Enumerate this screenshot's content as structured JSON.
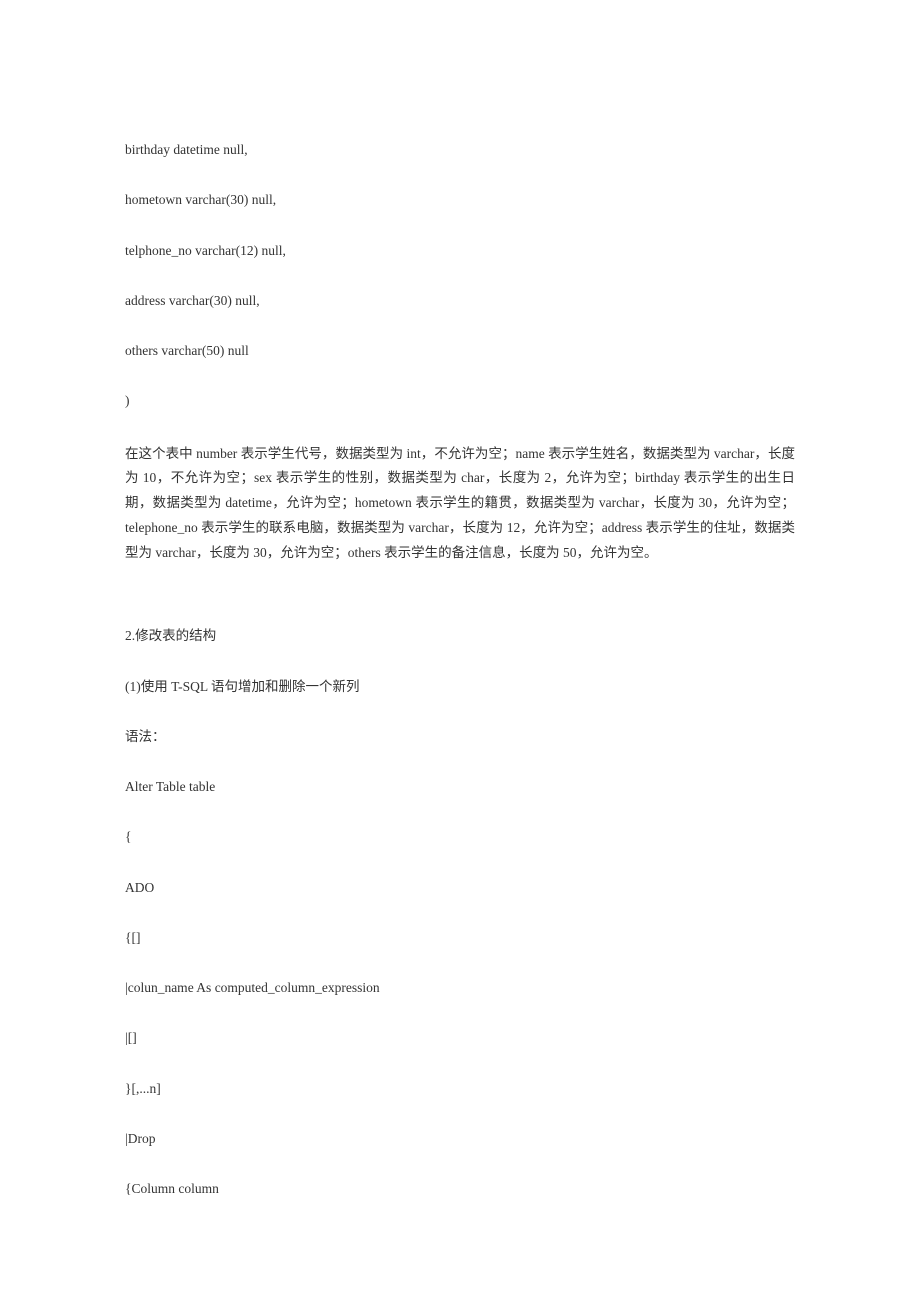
{
  "lines": [
    "birthday datetime null,",
    "hometown varchar(30) null,",
    "telphone_no varchar(12) null,",
    "address varchar(30) null,",
    "others varchar(50) null",
    ")"
  ],
  "paragraph": "在这个表中 number 表示学生代号，数据类型为 int，不允许为空；name 表示学生姓名，数据类型为 varchar，长度为 10，不允许为空；sex 表示学生的性别，数据类型为 char，长度为 2，允许为空；birthday 表示学生的出生日期，数据类型为 datetime，允许为空；hometown 表示学生的籍贯，数据类型为 varchar，长度为 30，允许为空；telephone_no 表示学生的联系电脑，数据类型为 varchar，长度为 12，允许为空；address 表示学生的住址，数据类型为 varchar，长度为 30，允许为空；others 表示学生的备注信息，长度为 50，允许为空。",
  "section2": "2.修改表的结构",
  "sub1": "(1)使用 T-SQL 语句增加和删除一个新列",
  "syntax_label": "语法：",
  "syntax_lines": [
    "Alter Table table",
    "{",
    "ADO",
    "{[]",
    "|colun_name As computed_column_expression",
    "|[]",
    "}[,...n]",
    "|Drop",
    "{Column column"
  ]
}
